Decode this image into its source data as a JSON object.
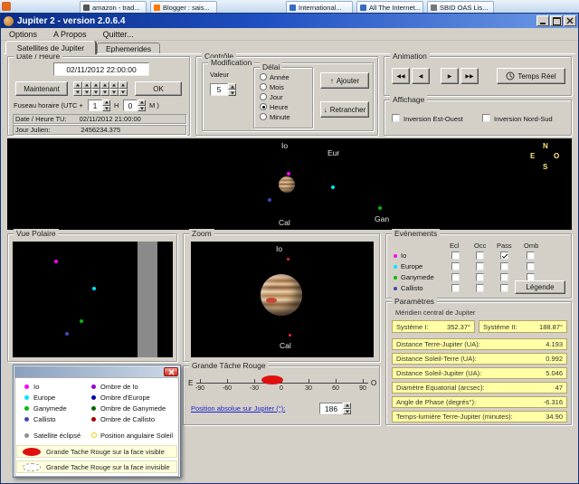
{
  "colors": {
    "window_chrome": "#d4d0c8",
    "titlebar_blue": "#0b2d84",
    "value_field_yellow": "#ffffa6",
    "grs_red": "#e01010",
    "io": "#ff00ff",
    "europe": "#00e5ff",
    "ganymede": "#00bb00",
    "callisto": "#4048b8",
    "ombre_io": "#9900cc",
    "ombre_europe": "#0000a0",
    "ombre_ganymede": "#006600",
    "ombre_callisto": "#aa0000",
    "satellite_eclipse_gray": "#909090",
    "soleil_yellow": "#e8d000"
  },
  "background_tabs": {
    "items": [
      {
        "label": "amazon - trad...",
        "icon_color": "#555555"
      },
      {
        "label": "Blogger : sais...",
        "icon_color": "#ff7700"
      },
      {
        "label": "International...",
        "icon_color": "#3a6abf"
      },
      {
        "label": "All The Internet...",
        "icon_color": "#3a6abf"
      },
      {
        "label": "SBID OAS Lis...",
        "icon_color": "#777777"
      }
    ]
  },
  "window": {
    "title": "Jupiter 2 - version 2.0.6.4",
    "menu": [
      "Options",
      "A Propos",
      "Quitter..."
    ]
  },
  "tabs": [
    {
      "label": "Satellites de Jupiter",
      "active": true
    },
    {
      "label": "Ephemerides",
      "active": false
    }
  ],
  "date_heure": {
    "legend": "Date / Heure",
    "datetime": "02/11/2012 22:00:00",
    "maintenant": "Maintenant",
    "ok": "OK",
    "fuseau_label": "Fuseau horaire (UTC +",
    "fuseau_h": "1",
    "h_label": "H",
    "fuseau_m": "0",
    "m_label": "M )",
    "tu_label": "Date / Heure TU:",
    "tu_value": "02/11/2012 21:00:00",
    "jj_label": "Jour Julien:",
    "jj_value": "2456234.375"
  },
  "controle": {
    "legend": "Contrôle",
    "modification": "Modification",
    "valeur_label": "Valeur",
    "valeur": "5",
    "delai_legend": "Délai",
    "delai_options": [
      {
        "label": "Année",
        "selected": false
      },
      {
        "label": "Mois",
        "selected": false
      },
      {
        "label": "Jour",
        "selected": false
      },
      {
        "label": "Heure",
        "selected": true
      },
      {
        "label": "Minute",
        "selected": false
      }
    ],
    "ajouter": "Ajouter",
    "retrancher": "Retrancher"
  },
  "animation": {
    "legend": "Animation",
    "buttons": [
      "◀◀",
      "◀",
      "▶",
      "▶▶"
    ],
    "temps_reel": "Temps Réel"
  },
  "affichage": {
    "legend": "Affichage",
    "inversion_eo": "Inversion Est-Ouest",
    "inversion_ns": "Inversion Nord-Sud",
    "inversion_eo_checked": false,
    "inversion_ns_checked": false
  },
  "sky_view": {
    "moon_labels": {
      "io": "Io",
      "eur": "Eur",
      "cal": "Cal",
      "gan": "Gan"
    },
    "compass": {
      "n": "N",
      "e": "E",
      "o": "O",
      "s": "S"
    }
  },
  "vue_polaire": {
    "legend": "Vue Polaire"
  },
  "zoom_view": {
    "legend": "Zoom",
    "io_label": "Io",
    "cal_label": "Cal"
  },
  "evenements": {
    "legend": "Evénements",
    "columns": [
      "Ecl",
      "Occ",
      "Pass",
      "Omb"
    ],
    "moons": [
      {
        "name": "Io",
        "color": "#ff00ff",
        "checks": {
          "Ecl": false,
          "Occ": false,
          "Pass": true,
          "Omb": false
        }
      },
      {
        "name": "Europe",
        "color": "#00e5ff",
        "checks": {
          "Ecl": false,
          "Occ": false,
          "Pass": false,
          "Omb": false
        }
      },
      {
        "name": "Ganymede",
        "color": "#00bb00",
        "checks": {
          "Ecl": false,
          "Occ": false,
          "Pass": false,
          "Omb": false
        }
      },
      {
        "name": "Callisto",
        "color": "#4048b8",
        "checks": {
          "Ecl": false,
          "Occ": false,
          "Pass": false,
          "Omb": false
        }
      }
    ],
    "legende_button": "Légende"
  },
  "parametres": {
    "legend": "Paramètres",
    "meridien": "Méridien central de Jupiter",
    "systeme1_label": "Système I:",
    "systeme1_value": "352.37°",
    "systeme2_label": "Système II:",
    "systeme2_value": "188.87°",
    "rows": [
      {
        "label": "Distance Terre-Jupiter (UA):",
        "value": "4.193"
      },
      {
        "label": "Distance Soleil-Terre (UA):",
        "value": "0.992"
      },
      {
        "label": "Distance Soleil-Jupiter (UA):",
        "value": "5.046"
      },
      {
        "label": "Diamètre Equatorial (arcsec):",
        "value": "47"
      },
      {
        "label": "Angle de Phase (degrés°):",
        "value": "-6.316"
      }
    ],
    "temps_label": "Temps-lumière Terre-Jupiter (minutes):",
    "temps_value": "34.90"
  },
  "grande_tache": {
    "legend": "Grande Tâche Rouge",
    "west_label": "E",
    "east_label": "O",
    "ticks": [
      "-90",
      "-60",
      "-30",
      "0",
      "30",
      "60",
      "90"
    ],
    "spot_scale_position": "-10",
    "position_link": "Position absolue sur Jupiter (°):",
    "position_value": "186"
  },
  "legende_popup": {
    "rows": [
      {
        "label": "Io",
        "color": "#ff00ff",
        "shadow_label": "Ombre de Io",
        "shadow_color": "#9900cc"
      },
      {
        "label": "Europe",
        "color": "#00e5ff",
        "shadow_label": "Ombre d'Europe",
        "shadow_color": "#0000a0"
      },
      {
        "label": "Ganymede",
        "color": "#00bb00",
        "shadow_label": "Ombre de Ganymede",
        "shadow_color": "#006600"
      },
      {
        "label": "Callisto",
        "color": "#4048b8",
        "shadow_label": "Ombre de Callisto",
        "shadow_color": "#aa0000"
      }
    ],
    "eclipsed_label": "Satellite éclipsé",
    "sun_label": "Position angulaire Soleil",
    "grs_visible_label": "Grande Tache Rouge sur la face visible",
    "grs_invisible_label": "Grande Tache Rouge sur la face invisible"
  }
}
